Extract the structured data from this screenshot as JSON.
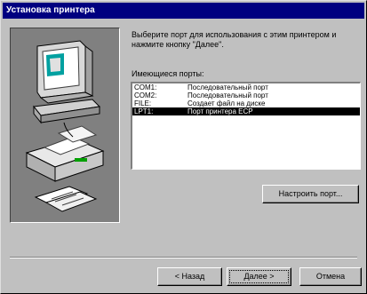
{
  "window": {
    "title": "Установка принтера"
  },
  "wizard": {
    "instruction": "Выберите порт для использования с этим принтером и нажмите кнопку \"Далее\".",
    "ports_label": "Имеющиеся порты:",
    "ports": [
      {
        "name": "COM1:",
        "description": "Последовательный порт"
      },
      {
        "name": "COM2:",
        "description": "Последовательный порт"
      },
      {
        "name": "FILE:",
        "description": "Создает файл на диске"
      },
      {
        "name": "LPT1:",
        "description": "Порт принтера ECP"
      }
    ],
    "selected_index": 3,
    "configure_button": "Настроить порт...",
    "back_button": "< Назад",
    "next_button": "Далее >",
    "cancel_button": "Отмена"
  },
  "colors": {
    "title_bar": "#000080",
    "face": "#c0c0c0",
    "art_panel": "#808080",
    "selection": "#000000"
  }
}
